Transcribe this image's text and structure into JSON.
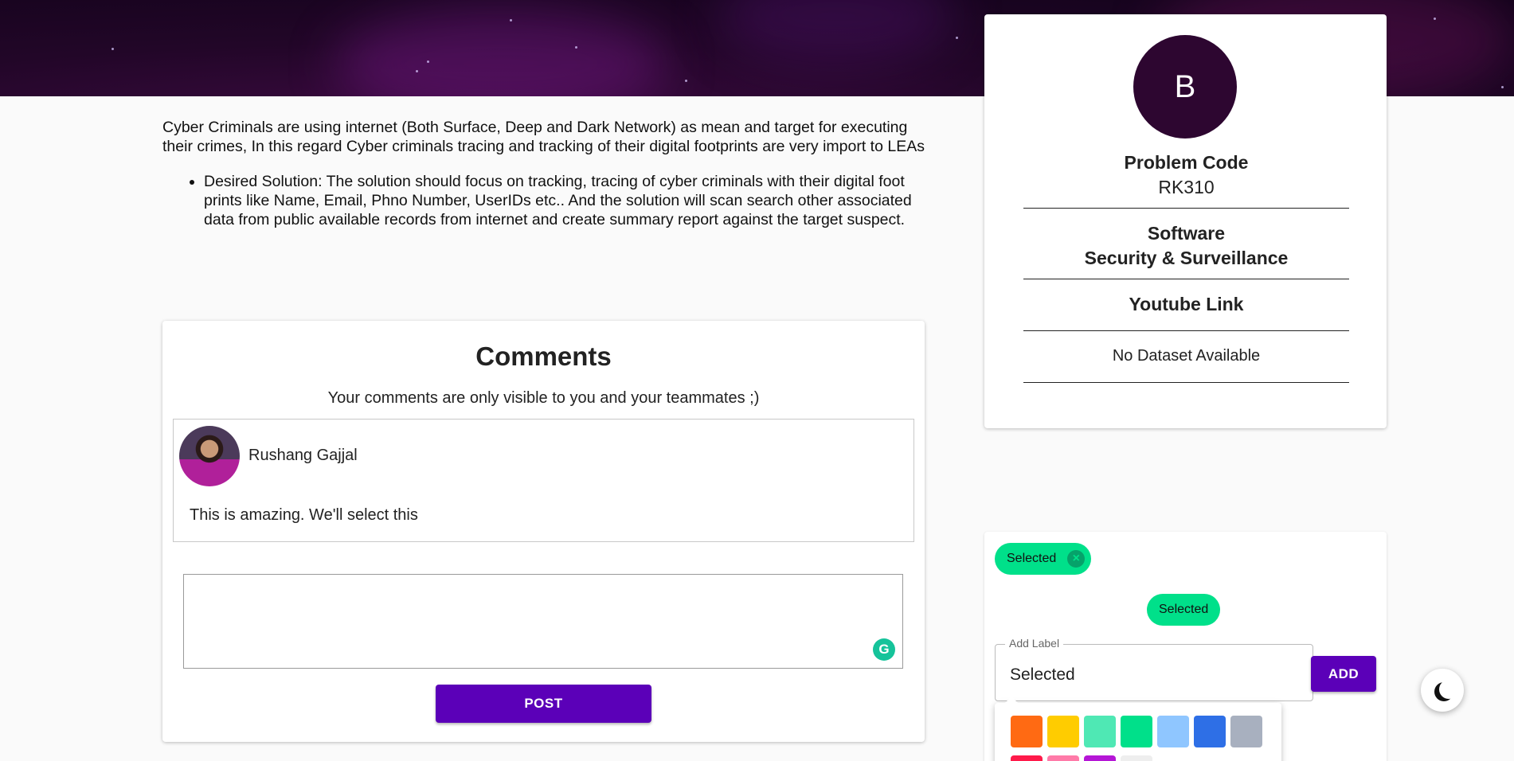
{
  "description": {
    "intro": "Cyber Criminals are using internet (Both Surface, Deep and Dark Network) as mean and target for executing their crimes, In this regard Cyber criminals tracing and tracking of their digital footprints are very import to LEAs",
    "bullets": [
      "Desired Solution: The solution should focus on tracking, tracing of cyber criminals with their digital foot prints like Name, Email, Phno Number, UserIDs etc.. And the solution will scan  search other associated data from public available records from internet and create summary report against the target suspect."
    ]
  },
  "comments": {
    "title": "Comments",
    "note": "Your comments are only visible to you and your teammates ;)",
    "items": [
      {
        "author": "Rushang Gajjal",
        "text": "This is amazing. We'll select this"
      }
    ],
    "post_label": "POST"
  },
  "problem": {
    "avatar_letter": "B",
    "code_label": "Problem Code",
    "code_value": "RK310",
    "category_line1": "Software",
    "category_line2": "Security & Surveillance",
    "youtube_label": "Youtube Link",
    "dataset_text": "No Dataset Available"
  },
  "labels": {
    "active_chip": "Selected",
    "preview_chip": "Selected",
    "field_label": "Add Label",
    "field_value": "Selected",
    "add_label": "ADD",
    "swatches_row1": [
      "#ff6a13",
      "#ffcc00",
      "#4fe8b4",
      "#00e08a",
      "#8fc6ff",
      "#2e6fe6",
      "#a8b0bf"
    ],
    "swatches_row2": [
      "#ff1a4a",
      "#ff7aa8",
      "#b516d6",
      "#eeeeee"
    ]
  },
  "colors": {
    "accent": "#5b00b8",
    "chip": "#00e08a",
    "avatar_bg": "#2d0630"
  },
  "icons": {
    "chip_remove": "close-circle-icon",
    "grammarly": "grammarly-icon",
    "theme": "moon-icon"
  }
}
